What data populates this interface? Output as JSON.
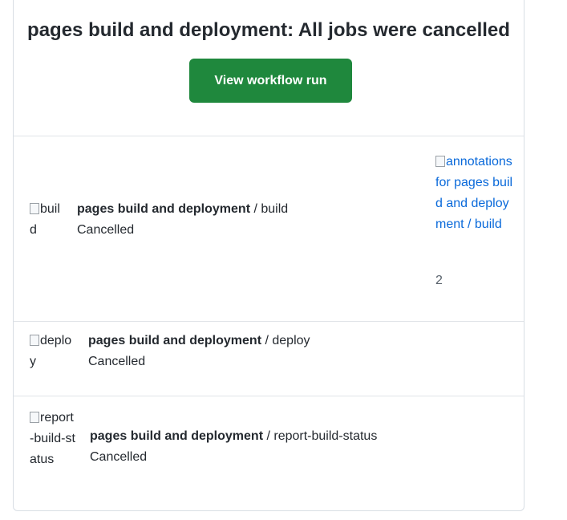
{
  "header": {
    "title": "pages build and deployment: All jobs were cancelled",
    "button_label": "View workflow run"
  },
  "jobs": [
    {
      "icon_alt": "build",
      "workflow": "pages build and deployment",
      "separator": " / ",
      "job": "build",
      "status": "Cancelled",
      "annotation_alt": "annotations for pages build and deployment / build",
      "annotation_count": "2"
    },
    {
      "icon_alt": "deploy",
      "workflow": "pages build and deployment",
      "separator": " / ",
      "job": "deploy",
      "status": "Cancelled"
    },
    {
      "icon_alt": "report-build-status",
      "workflow": "pages build and deployment",
      "separator": " / ",
      "job": "report-build-status",
      "status": "Cancelled"
    }
  ],
  "colors": {
    "button_bg": "#1f883d",
    "link": "#0969da",
    "border": "#d8dee4"
  }
}
